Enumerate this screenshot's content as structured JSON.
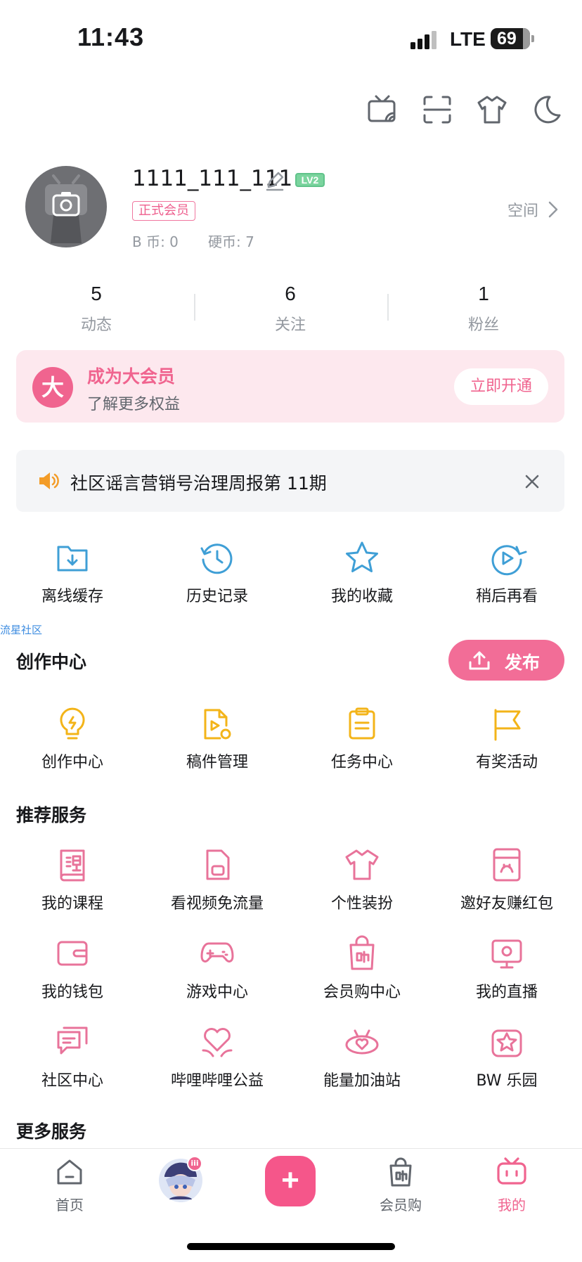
{
  "status_bar": {
    "time": "11:43",
    "network": "LTE",
    "battery": "69"
  },
  "top_icons": [
    "tv-cast-icon",
    "scan-icon",
    "shirt-icon",
    "moon-icon"
  ],
  "profile": {
    "username": "1111_111_111",
    "level": "LV2",
    "member_tag": "正式会员",
    "b_coins": "B 币: 0",
    "coins": "硬币: 7",
    "space_link": "空间"
  },
  "stats": [
    {
      "value": "5",
      "label": "动态"
    },
    {
      "value": "6",
      "label": "关注"
    },
    {
      "value": "1",
      "label": "粉丝"
    }
  ],
  "vip": {
    "badge": "大",
    "title": "成为大会员",
    "subtitle": "了解更多权益",
    "button": "立即开通"
  },
  "notice": {
    "text": "社区谣言营销号治理周报第 11期"
  },
  "quick_actions": [
    {
      "label": "离线缓存",
      "icon": "download-folder-icon"
    },
    {
      "label": "历史记录",
      "icon": "history-clock-icon"
    },
    {
      "label": "我的收藏",
      "icon": "star-icon"
    },
    {
      "label": "稍后再看",
      "icon": "watch-later-icon"
    }
  ],
  "floating_tag": "流星社区",
  "creation": {
    "title": "创作中心",
    "publish_button": "发布",
    "items": [
      {
        "label": "创作中心",
        "icon": "lightbulb-icon"
      },
      {
        "label": "稿件管理",
        "icon": "manuscript-icon"
      },
      {
        "label": "任务中心",
        "icon": "clipboard-icon"
      },
      {
        "label": "有奖活动",
        "icon": "flag-icon"
      }
    ]
  },
  "recommended": {
    "title": "推荐服务",
    "items": [
      {
        "label": "我的课程",
        "icon": "course-book-icon"
      },
      {
        "label": "看视频免流量",
        "icon": "sim-card-icon"
      },
      {
        "label": "个性装扮",
        "icon": "shirt-icon"
      },
      {
        "label": "邀好友赚红包",
        "icon": "red-envelope-icon"
      },
      {
        "label": "我的钱包",
        "icon": "wallet-icon"
      },
      {
        "label": "游戏中心",
        "icon": "gamepad-icon"
      },
      {
        "label": "会员购中心",
        "icon": "shopping-bag-icon"
      },
      {
        "label": "我的直播",
        "icon": "live-screen-icon"
      },
      {
        "label": "社区中心",
        "icon": "chat-bubbles-icon"
      },
      {
        "label": "哔哩哔哩公益",
        "icon": "heart-hands-icon"
      },
      {
        "label": "能量加油站",
        "icon": "energy-heart-icon"
      },
      {
        "label": "BW 乐园",
        "icon": "star-badge-icon"
      }
    ]
  },
  "more_services": {
    "title": "更多服务"
  },
  "tab_bar": {
    "home": "首页",
    "shop": "会员购",
    "mine": "我的",
    "avatar_badge": "iii"
  },
  "colors": {
    "pink": "#f0648f",
    "blue": "#3f9fd6",
    "yellow": "#f3b419",
    "text": "#18191c",
    "gray": "#9499a0"
  }
}
